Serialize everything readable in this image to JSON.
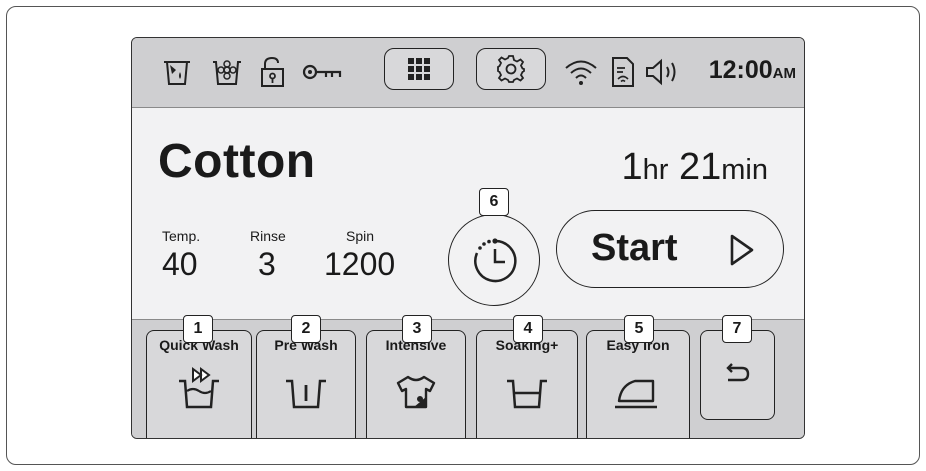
{
  "status": {
    "icons": [
      "detergent-icon",
      "fabric-softener-icon",
      "unlock-icon",
      "child-lock-key-icon",
      "wifi-icon",
      "smart-control-icon",
      "sound-icon"
    ],
    "time": "12:00",
    "ampm": "AM"
  },
  "program": {
    "name": "Cotton",
    "duration_hours": "1",
    "hours_unit": "hr",
    "duration_minutes": "21",
    "minutes_unit": "min"
  },
  "params": {
    "temp": {
      "label": "Temp.",
      "value": "40"
    },
    "rinse": {
      "label": "Rinse",
      "value": "3"
    },
    "spin": {
      "label": "Spin",
      "value": "1200"
    }
  },
  "start_label": "Start",
  "callouts": [
    "1",
    "2",
    "3",
    "4",
    "5",
    "6",
    "7"
  ],
  "functions": [
    {
      "label": "Quick Wash",
      "icon": "quick-wash-icon"
    },
    {
      "label": "Pre Wash",
      "icon": "pre-wash-icon"
    },
    {
      "label": "Intensive",
      "icon": "intensive-icon"
    },
    {
      "label": "Soaking+",
      "icon": "soaking-icon"
    },
    {
      "label": "Easy Iron",
      "icon": "easy-iron-icon"
    }
  ]
}
